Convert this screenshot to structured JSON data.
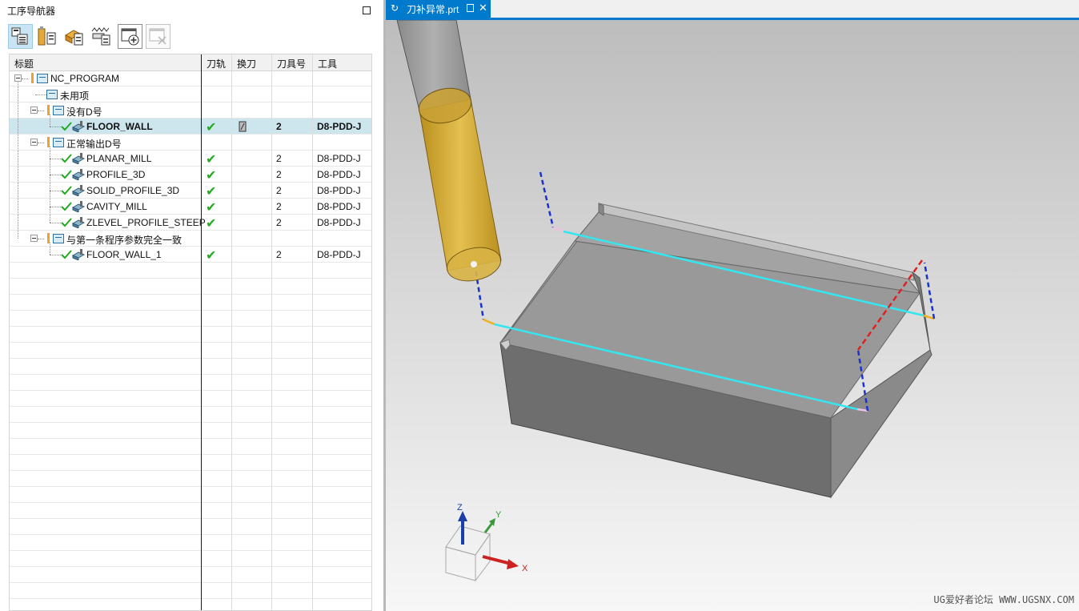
{
  "navigator": {
    "title": "工序导航器",
    "toolbar_icons": [
      "program-order-view-icon",
      "machine-tool-view-icon",
      "geometry-view-icon",
      "method-view-icon",
      "create-operation-icon",
      "delete-operation-icon"
    ],
    "columns": [
      "标题",
      "刀轨",
      "换刀",
      "刀具号",
      "工具"
    ],
    "rows": [
      {
        "name": "NC_PROGRAM",
        "level": 0,
        "kind": "program-root",
        "path": "",
        "toolchange": false,
        "tool_no": "",
        "tool": "",
        "bold": false,
        "selected": false
      },
      {
        "name": "未用项",
        "level": 1,
        "kind": "unused-group",
        "path": "",
        "toolchange": false,
        "tool_no": "",
        "tool": "",
        "bold": false,
        "selected": false
      },
      {
        "name": "没有D号",
        "level": 1,
        "kind": "program-group",
        "path": "",
        "toolchange": false,
        "tool_no": "",
        "tool": "",
        "bold": false,
        "selected": false
      },
      {
        "name": "FLOOR_WALL",
        "level": 2,
        "kind": "operation",
        "path": "✔",
        "toolchange": true,
        "tool_no": "2",
        "tool": "D8-PDD-J",
        "bold": true,
        "selected": true
      },
      {
        "name": "正常输出D号",
        "level": 1,
        "kind": "program-group",
        "path": "",
        "toolchange": false,
        "tool_no": "",
        "tool": "",
        "bold": false,
        "selected": false
      },
      {
        "name": "PLANAR_MILL",
        "level": 2,
        "kind": "operation",
        "path": "✔",
        "toolchange": false,
        "tool_no": "2",
        "tool": "D8-PDD-J",
        "bold": false,
        "selected": false
      },
      {
        "name": "PROFILE_3D",
        "level": 2,
        "kind": "operation",
        "path": "✔",
        "toolchange": false,
        "tool_no": "2",
        "tool": "D8-PDD-J",
        "bold": false,
        "selected": false
      },
      {
        "name": "SOLID_PROFILE_3D",
        "level": 2,
        "kind": "operation",
        "path": "✔",
        "toolchange": false,
        "tool_no": "2",
        "tool": "D8-PDD-J",
        "bold": false,
        "selected": false
      },
      {
        "name": "CAVITY_MILL",
        "level": 2,
        "kind": "operation",
        "path": "✔",
        "toolchange": false,
        "tool_no": "2",
        "tool": "D8-PDD-J",
        "bold": false,
        "selected": false
      },
      {
        "name": "ZLEVEL_PROFILE_STEEP",
        "level": 2,
        "kind": "operation",
        "path": "✔",
        "toolchange": false,
        "tool_no": "2",
        "tool": "D8-PDD-J",
        "bold": false,
        "selected": false
      },
      {
        "name": "与第一条程序参数完全一致",
        "level": 1,
        "kind": "program-group",
        "path": "",
        "toolchange": false,
        "tool_no": "",
        "tool": "",
        "bold": false,
        "selected": false
      },
      {
        "name": "FLOOR_WALL_1",
        "level": 2,
        "kind": "operation",
        "path": "✔",
        "toolchange": false,
        "tool_no": "2",
        "tool": "D8-PDD-J",
        "bold": false,
        "selected": false
      }
    ]
  },
  "viewport": {
    "tab_label": "刀补异常.prt",
    "axis_labels": {
      "x": "X",
      "y": "Y",
      "z": "Z"
    },
    "watermark": "UG爱好者论坛 WWW.UGSNX.COM",
    "colors": {
      "tab": "#007acc",
      "tool_body": "#d4a92b",
      "part": "#8c8c8c",
      "cut_path": "#33e6f0",
      "rapid_path": "#1a33cc",
      "engage_path": "#dd2222"
    }
  }
}
